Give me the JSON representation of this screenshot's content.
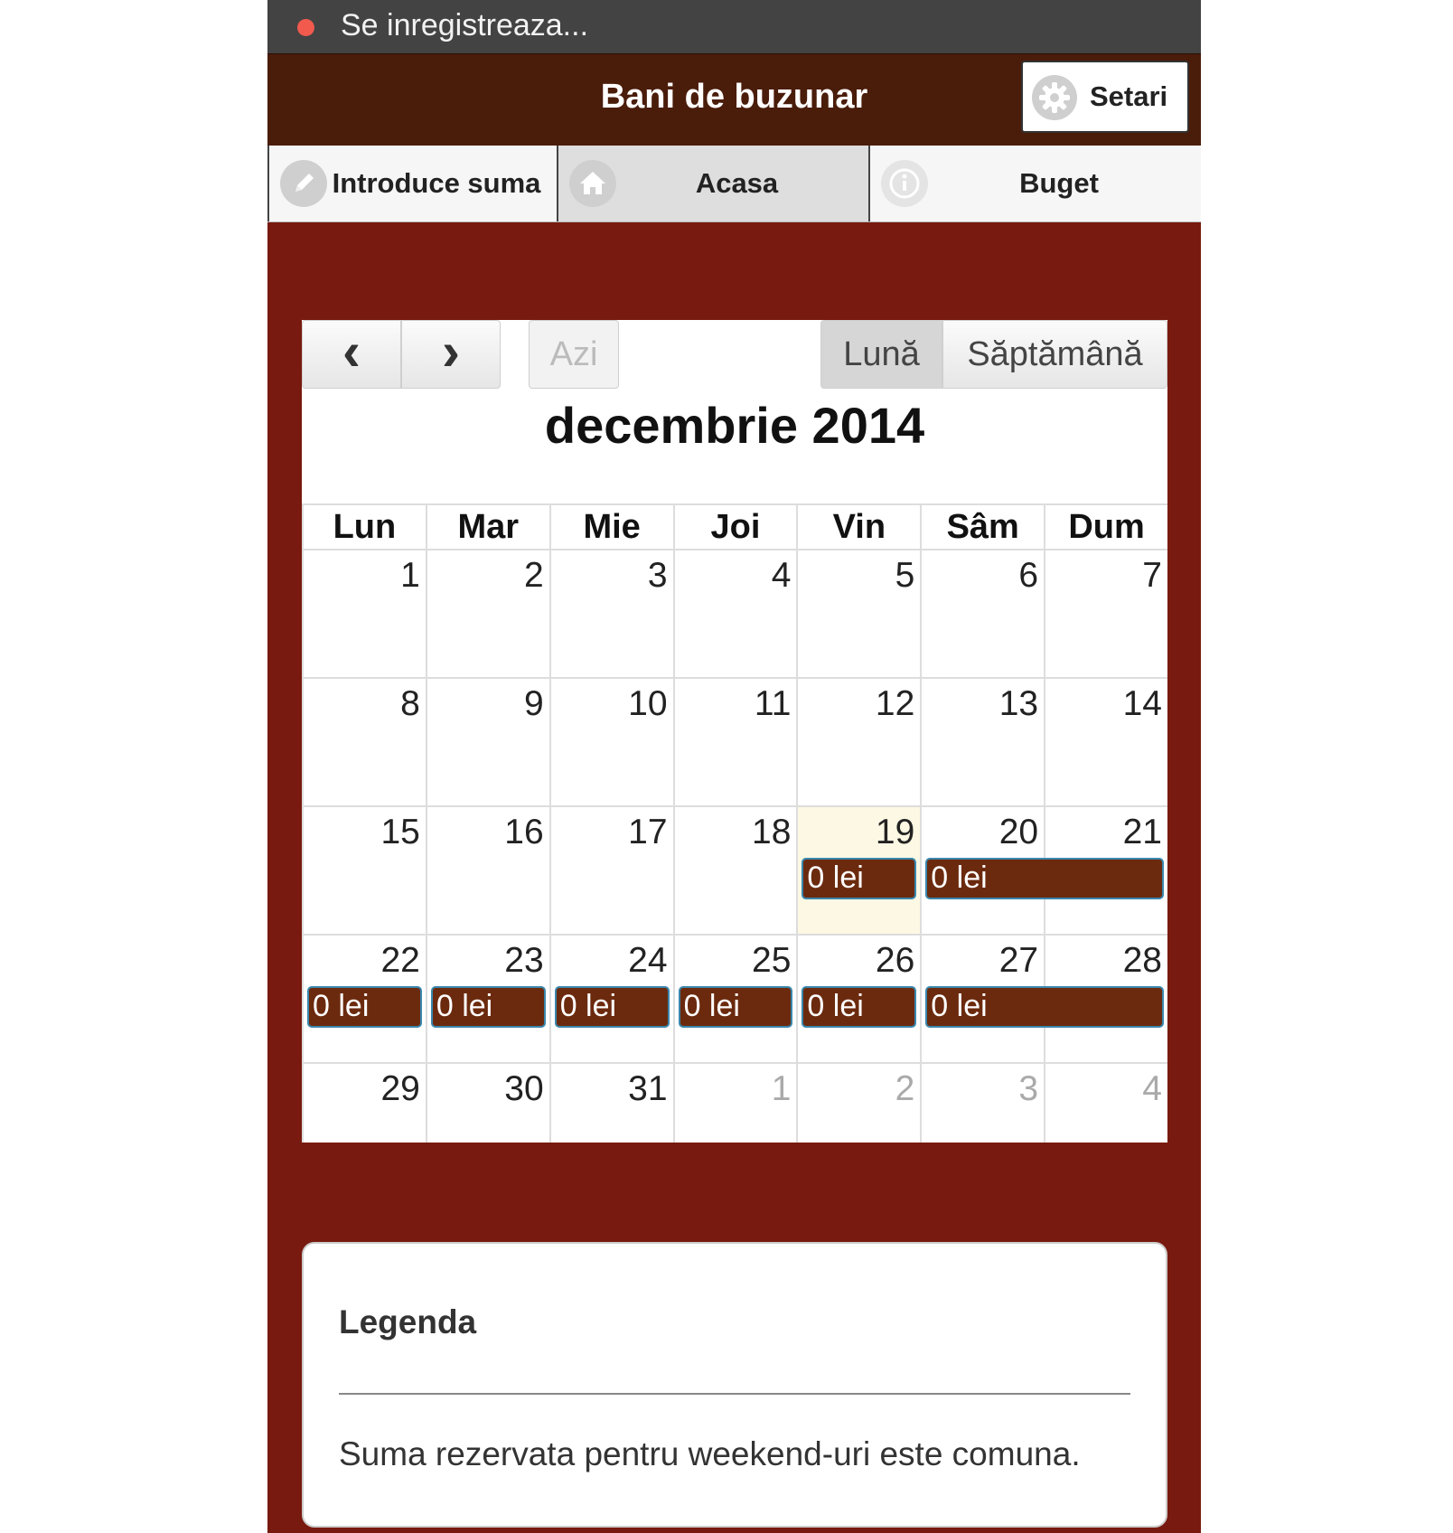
{
  "statusbar": {
    "recording_text": "Se inregistreaza..."
  },
  "header": {
    "title": "Bani de buzunar",
    "settings_label": "Setari",
    "settings_icon": "gear-icon"
  },
  "nav": [
    {
      "label": "Introduce suma",
      "icon": "pencil-icon"
    },
    {
      "label": "Acasa",
      "icon": "home-icon",
      "active": true
    },
    {
      "label": "Buget",
      "icon": "info-icon"
    }
  ],
  "calendar": {
    "prev": "‹",
    "next": "›",
    "today": "Azi",
    "view_month": "Lună",
    "view_week": "Săptămână",
    "title": "decembrie 2014",
    "weekdays": [
      "Lun",
      "Mar",
      "Mie",
      "Joi",
      "Vin",
      "Sâm",
      "Dum"
    ],
    "weeks": [
      [
        "1",
        "2",
        "3",
        "4",
        "5",
        "6",
        "7"
      ],
      [
        "8",
        "9",
        "10",
        "11",
        "12",
        "13",
        "14"
      ],
      [
        "15",
        "16",
        "17",
        "18",
        "19",
        "20",
        "21"
      ],
      [
        "22",
        "23",
        "24",
        "25",
        "26",
        "27",
        "28"
      ],
      [
        "29",
        "30",
        "31",
        "1",
        "2",
        "3",
        "4"
      ]
    ],
    "today_cell": [
      2,
      4
    ],
    "events": [
      {
        "week": 2,
        "start": 4,
        "span": 1,
        "label": "0 lei"
      },
      {
        "week": 2,
        "start": 5,
        "span": 2,
        "label": "0 lei"
      },
      {
        "week": 3,
        "start": 0,
        "span": 1,
        "label": "0 lei"
      },
      {
        "week": 3,
        "start": 1,
        "span": 1,
        "label": "0 lei"
      },
      {
        "week": 3,
        "start": 2,
        "span": 1,
        "label": "0 lei"
      },
      {
        "week": 3,
        "start": 3,
        "span": 1,
        "label": "0 lei"
      },
      {
        "week": 3,
        "start": 4,
        "span": 1,
        "label": "0 lei"
      },
      {
        "week": 3,
        "start": 5,
        "span": 2,
        "label": "0 lei"
      }
    ],
    "colors": {
      "event_bg": "#6b2a0e",
      "event_border": "#3a87ad",
      "today_bg": "#fcf8e3"
    }
  },
  "legend": {
    "title": "Legenda",
    "text": "Suma rezervata pentru weekend-uri este comuna."
  },
  "colors": {
    "page_bg": "#781a0f",
    "header_bg": "#4a1c0a",
    "statusbar_bg": "#434343"
  }
}
